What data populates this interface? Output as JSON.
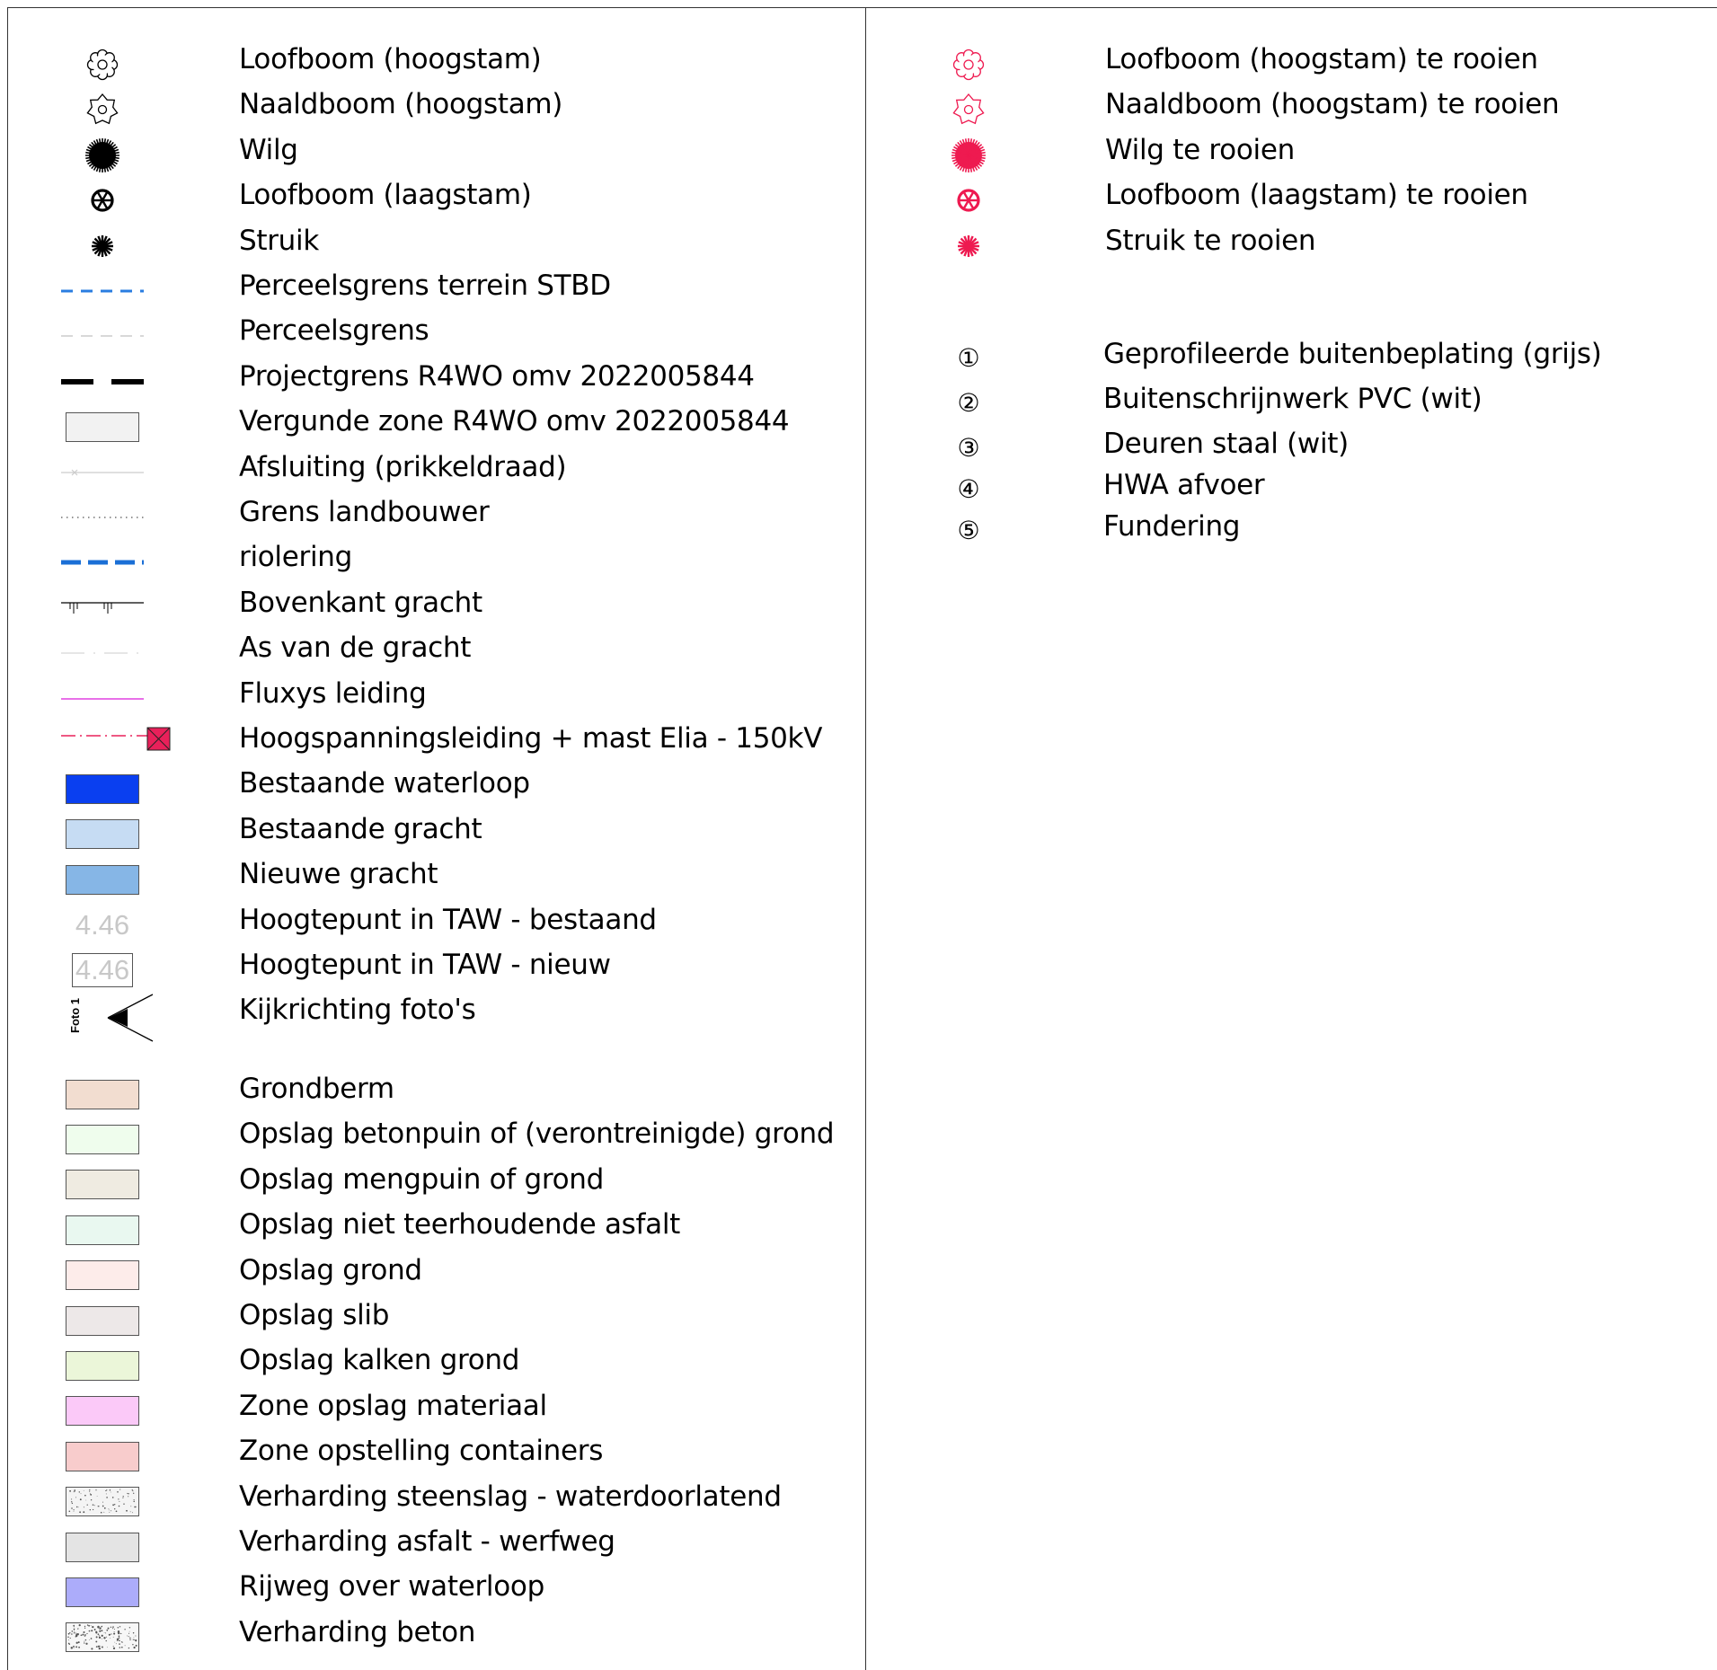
{
  "left_legend": [
    {
      "id": "loofboom-hoog",
      "label": "Loofboom (hoogstam)",
      "symbol": "flower-outline-icon",
      "color": "#000000"
    },
    {
      "id": "naaldboom-hoog",
      "label": "Naaldboom (hoogstam)",
      "symbol": "star-outline-icon",
      "color": "#000000"
    },
    {
      "id": "wilg",
      "label": "Wilg",
      "symbol": "burst-filled-icon",
      "color": "#000000"
    },
    {
      "id": "loofboom-laag",
      "label": "Loofboom (laagstam)",
      "symbol": "wheel-icon",
      "color": "#000000"
    },
    {
      "id": "struik",
      "label": "Struik",
      "symbol": "asterisk-icon",
      "color": "#000000"
    },
    {
      "id": "perceelsgrens-stbd",
      "label": "Perceelsgrens terrein STBD",
      "symbol": "dashed-line-blue",
      "color": "#2a7de1"
    },
    {
      "id": "perceelsgrens",
      "label": "Perceelsgrens",
      "symbol": "dashed-line-light",
      "color": "#cccccc"
    },
    {
      "id": "projectgrens",
      "label": "Projectgrens R4WO omv 2022005844",
      "symbol": "thick-dashed-line",
      "color": "#000000"
    },
    {
      "id": "vergunde-zone",
      "label": "Vergunde zone R4WO omv 2022005844",
      "symbol": "swatch",
      "color": "#f2f2f2"
    },
    {
      "id": "afsluiting",
      "label": "Afsluiting (prikkeldraad)",
      "symbol": "barbed-line",
      "color": "#cccccc"
    },
    {
      "id": "grens-landbouwer",
      "label": "Grens landbouwer",
      "symbol": "dotted-line",
      "color": "#555555"
    },
    {
      "id": "riolering",
      "label": "riolering",
      "symbol": "thick-dashed-line-blue",
      "color": "#1a6fd6"
    },
    {
      "id": "bovenkant-gracht",
      "label": "Bovenkant gracht",
      "symbol": "tick-line",
      "color": "#000000"
    },
    {
      "id": "as-gracht",
      "label": "As van de gracht",
      "symbol": "dashdot-line",
      "color": "#dddddd"
    },
    {
      "id": "fluxys",
      "label": "Fluxys leiding",
      "symbol": "solid-line-magenta",
      "color": "#e040e0"
    },
    {
      "id": "hoogspanning",
      "label": "Hoogspanningsleiding + mast Elia - 150kV",
      "symbol": "line-with-mast",
      "color": "#e8205a"
    },
    {
      "id": "bestaande-waterloop",
      "label": "Bestaande waterloop",
      "symbol": "swatch",
      "color": "#0a3ff0"
    },
    {
      "id": "bestaande-gracht",
      "label": "Bestaande gracht",
      "symbol": "swatch",
      "color": "#c6dcf3"
    },
    {
      "id": "nieuwe-gracht",
      "label": "Nieuwe gracht",
      "symbol": "swatch",
      "color": "#86b6e6"
    },
    {
      "id": "hoogtepunt-bestaand",
      "label": "Hoogtepunt in TAW - bestaand",
      "symbol": "height-text",
      "value": "4.46"
    },
    {
      "id": "hoogtepunt-nieuw",
      "label": "Hoogtepunt in TAW - nieuw",
      "symbol": "height-text-boxed",
      "value": "4.46"
    },
    {
      "id": "kijkrichting",
      "label": "Kijkrichting foto's",
      "symbol": "view-direction",
      "value": "Foto 1"
    },
    {
      "id": "grondberm",
      "label": "Grondberm",
      "symbol": "swatch",
      "color": "#f2ddd0"
    },
    {
      "id": "opslag-betonpuin",
      "label": "Opslag betonpuin of (verontreinigde) grond",
      "symbol": "swatch",
      "color": "#effded"
    },
    {
      "id": "opslag-mengpuin",
      "label": "Opslag mengpuin of grond",
      "symbol": "swatch",
      "color": "#efebe1"
    },
    {
      "id": "opslag-asfalt",
      "label": "Opslag niet teerhoudende asfalt",
      "symbol": "swatch",
      "color": "#e9f8f0"
    },
    {
      "id": "opslag-grond",
      "label": "Opslag grond",
      "symbol": "swatch",
      "color": "#fdecea"
    },
    {
      "id": "opslag-slib",
      "label": "Opslag slib",
      "symbol": "swatch",
      "color": "#ede8e8"
    },
    {
      "id": "opslag-kalken",
      "label": "Opslag kalken grond",
      "symbol": "swatch",
      "color": "#ebf6d9"
    },
    {
      "id": "zone-opslag-materiaal",
      "label": "Zone opslag materiaal",
      "symbol": "swatch",
      "color": "#fbc9f8"
    },
    {
      "id": "zone-containers",
      "label": "Zone opstelling containers",
      "symbol": "swatch",
      "color": "#f8cccc"
    },
    {
      "id": "steenslag",
      "label": "Verharding steenslag - waterdoorlatend",
      "symbol": "speckled-swatch",
      "color": "#f4f4f4"
    },
    {
      "id": "asfalt-werfweg",
      "label": "Verharding asfalt - werfweg",
      "symbol": "swatch",
      "color": "#e4e4e4"
    },
    {
      "id": "rijweg",
      "label": "Rijweg over waterloop",
      "symbol": "swatch",
      "color": "#acacfa"
    },
    {
      "id": "beton",
      "label": "Verharding beton",
      "symbol": "speckled-swatch-dense",
      "color": "#f7f7f7"
    }
  ],
  "right_legend": [
    {
      "id": "loofboom-hoog-rooien",
      "label": "Loofboom (hoogstam) te rooien",
      "symbol": "flower-outline-icon",
      "color": "#ee1a50"
    },
    {
      "id": "naaldboom-hoog-rooien",
      "label": "Naaldboom (hoogstam) te rooien",
      "symbol": "star-outline-icon",
      "color": "#ee1a50"
    },
    {
      "id": "wilg-rooien",
      "label": "Wilg te rooien",
      "symbol": "burst-filled-icon",
      "color": "#ee1a50"
    },
    {
      "id": "loofboom-laag-rooien",
      "label": "Loofboom (laagstam) te rooien",
      "symbol": "wheel-icon",
      "color": "#ee1a50"
    },
    {
      "id": "struik-rooien",
      "label": "Struik te rooien",
      "symbol": "asterisk-icon",
      "color": "#ee1a50"
    }
  ],
  "materials": [
    {
      "num": "①",
      "label": "Geprofileerde buitenbeplating (grijs)"
    },
    {
      "num": "②",
      "label": "Buitenschrijnwerk PVC (wit)"
    },
    {
      "num": "③",
      "label": "Deuren staal (wit)"
    },
    {
      "num": "④",
      "label": "HWA afvoer"
    },
    {
      "num": "⑤",
      "label": "Fundering"
    }
  ]
}
